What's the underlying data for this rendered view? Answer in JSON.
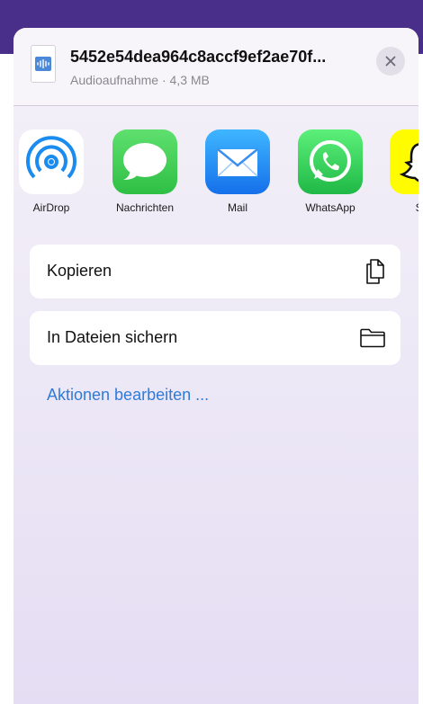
{
  "file": {
    "name": "5452e54dea964c8accf9ef2ae70f...",
    "meta": "Audioaufnahme · 4,3 MB"
  },
  "close_icon": "close-icon",
  "apps": [
    {
      "label": "AirDrop",
      "icon": "airdrop-icon",
      "color": "#ffffff"
    },
    {
      "label": "Nachrichten",
      "icon": "messages-icon",
      "color": "#34c759"
    },
    {
      "label": "Mail",
      "icon": "mail-icon",
      "color": "#1e8cf0"
    },
    {
      "label": "WhatsApp",
      "icon": "whatsapp-icon",
      "color": "#25d366"
    },
    {
      "label": "Sn",
      "icon": "snapchat-icon",
      "color": "#fffc00"
    }
  ],
  "actions": [
    {
      "label": "Kopieren",
      "icon": "copy-icon"
    },
    {
      "label": "In Dateien sichern",
      "icon": "folder-icon"
    }
  ],
  "edit_actions": "Aktionen bearbeiten ..."
}
